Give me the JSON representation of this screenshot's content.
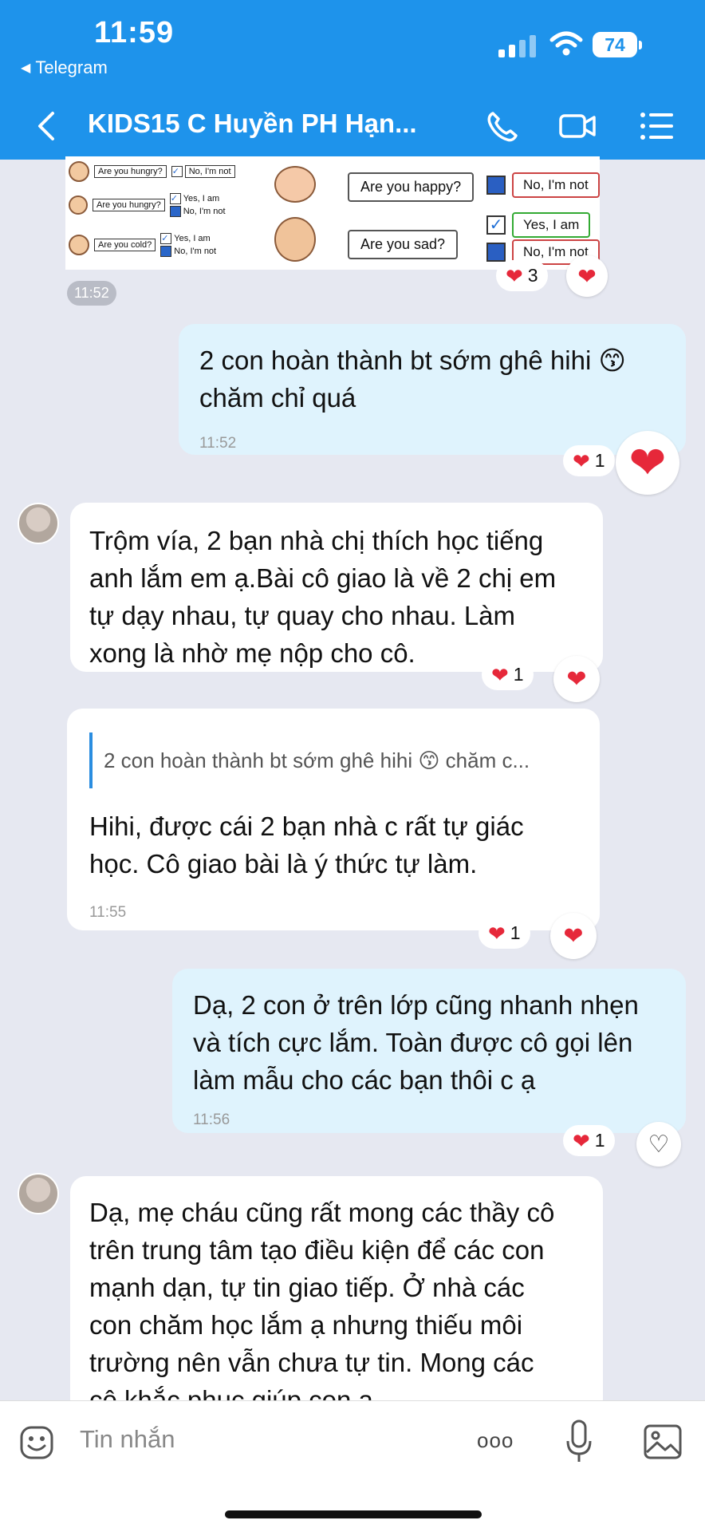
{
  "status_bar": {
    "time": "11:59",
    "back_app": "Telegram",
    "battery": "74"
  },
  "header": {
    "title": "KIDS15 C Huyền PH Hạn...",
    "bg_color": "#1e93eb",
    "icons": [
      "back-icon",
      "phone-icon",
      "video-call-icon",
      "menu-icon"
    ]
  },
  "image_message": {
    "small_rows": [
      {
        "question": "Are you hungry?",
        "answers": [
          "No, I'm not"
        ]
      },
      {
        "question": "Are you hungry?",
        "answers": [
          "Yes, I am",
          "No, I'm not"
        ]
      },
      {
        "question": "Are you cold?",
        "answers": [
          "Yes, I am",
          "No, I'm not"
        ]
      }
    ],
    "big_rows": [
      {
        "question": "Are you happy?",
        "answer": "No, I'm not"
      },
      {
        "question": "Are you sad?",
        "answers": [
          "Yes, I am",
          "No, I'm not"
        ]
      }
    ],
    "time": "11:52",
    "reaction_count": "3"
  },
  "messages": [
    {
      "id": "m1",
      "direction": "out",
      "text_lines": [
        "2 con hoàn thành bt sớm ghê hihi 😙",
        "chăm chỉ quá"
      ],
      "time": "11:52",
      "reaction_count": "1"
    },
    {
      "id": "m2",
      "direction": "in",
      "text_lines": [
        "Trộm vía, 2 bạn nhà chị thích học tiếng",
        "anh lắm em ạ.Bài cô giao là về 2 chị em",
        "tự dạy nhau, tự quay cho nhau. Làm",
        "xong là nhờ mẹ nộp cho cô."
      ],
      "reaction_count": "1"
    },
    {
      "id": "m3",
      "direction": "in",
      "reply_to": "2 con hoàn thành bt sớm ghê hihi 😙 chăm c...",
      "text_lines": [
        "Hihi, được cái 2 bạn nhà c rất tự giác",
        "học. Cô giao bài là ý thức tự làm."
      ],
      "time": "11:55",
      "reaction_count": "1"
    },
    {
      "id": "m4",
      "direction": "out",
      "text_lines": [
        "Dạ, 2 con ở trên lớp cũng nhanh nhẹn",
        "và tích cực lắm. Toàn được cô gọi lên",
        "làm mẫu cho các bạn thôi c ạ"
      ],
      "time": "11:56",
      "reaction_count": "1"
    },
    {
      "id": "m5",
      "direction": "in",
      "text_lines": [
        "Dạ, mẹ cháu cũng rất mong các thầy cô",
        "trên trung tâm tạo điều kiện để các con",
        "mạnh dạn, tự tin giao tiếp. Ở nhà các",
        "con chăm học lắm ạ nhưng thiếu môi",
        "trường nên vẫn chưa tự tin. Mong các",
        "cô khắc phục giúp con ạ."
      ]
    }
  ],
  "input_bar": {
    "placeholder": "Tin nhắn",
    "more_label": "ooo"
  }
}
